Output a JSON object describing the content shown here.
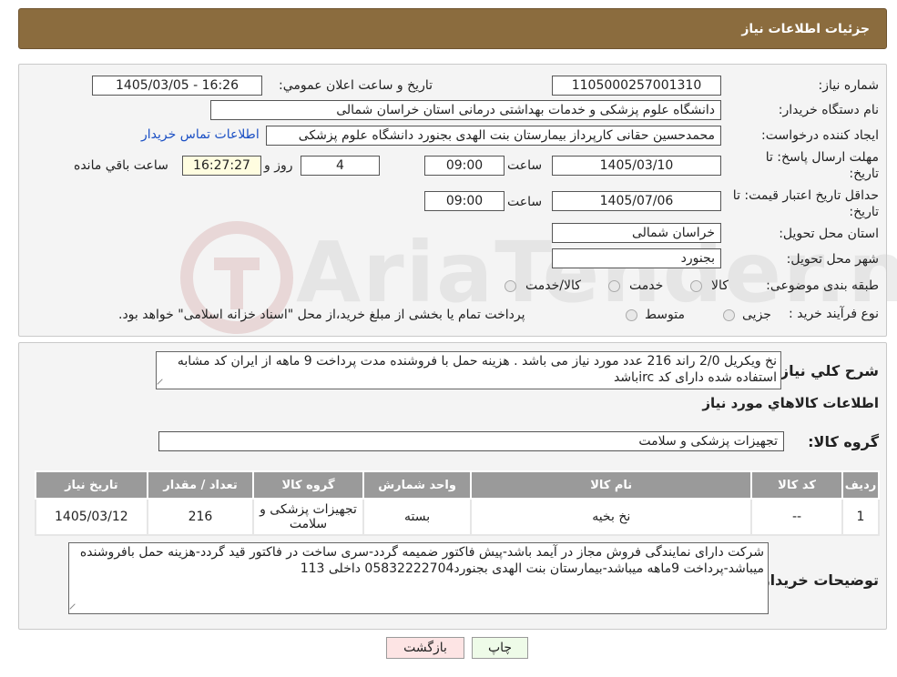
{
  "header": {
    "title": "جزئیات اطلاعات نیاز"
  },
  "form": {
    "need_number_label": "شماره نیاز:",
    "need_number": "1105000257001310",
    "announce_label": "تاریخ و ساعت اعلان عمومي:",
    "announce_value": "1405/03/05 - 16:26",
    "buyer_org_label": "نام دستگاه خريدار:",
    "buyer_org": "دانشگاه علوم پزشکی و خدمات بهداشتی درمانی استان خراسان شمالی",
    "requester_label": "ايجاد کننده درخواست:",
    "requester": "محمدحسین حقانی کارپرداز بیمارستان بنت الهدی بجنورد دانشگاه علوم پزشکی",
    "contact_link": "اطلاعات تماس خريدار",
    "deadline_label": "مهلت ارسال پاسخ: تا تاريخ:",
    "deadline_date": "1405/03/10",
    "time_label": "ساعت",
    "deadline_time": "09:00",
    "days_value": "4",
    "days_label": "روز و",
    "remaining_time": "16:27:27",
    "remaining_label": "ساعت باقي مانده",
    "validity_label": "حداقل تاريخ اعتبار قيمت: تا تاريخ:",
    "validity_date": "1405/07/06",
    "validity_time": "09:00",
    "province_label": "استان محل تحويل:",
    "province": "خراسان شمالی",
    "city_label": "شهر محل تحويل:",
    "city": "بجنورد",
    "category_label": "طبقه بندی موضوعی:",
    "category_options": [
      "کالا",
      "خدمت",
      "کالا/خدمت"
    ],
    "process_label": "نوع فرآيند خريد :",
    "process_options": [
      "جزیی",
      "متوسط"
    ],
    "process_note": "پرداخت تمام یا بخشی از مبلغ خرید،از محل \"اسناد خزانه اسلامی\" خواهد بود."
  },
  "description": {
    "label": "شرح کلي نياز:",
    "text": "نخ ویکریل 2/0 راند 216 عدد مورد نیاز می باشد . هزینه حمل با فروشنده مدت پرداخت 9 ماهه از ایران کد مشابه استفاده شده دارای کد ircباشد"
  },
  "goods": {
    "section_title": "اطلاعات کالاهاي مورد نياز",
    "group_label": "گروه کالا:",
    "group_value": "تجهیزات پزشکی و سلامت",
    "columns": [
      "رديف",
      "کد کالا",
      "نام کالا",
      "واحد شمارش",
      "گروه کالا",
      "تعداد / مقدار",
      "تاريخ نياز"
    ],
    "rows": [
      [
        "1",
        "--",
        "نخ بخیه",
        "بسته",
        "تجهیزات پزشکی و سلامت",
        "216",
        "1405/03/12"
      ]
    ]
  },
  "buyer_notes": {
    "label": "توضيحات خريدار:",
    "text": "شرکت دارای نمایندگی فروش مجاز در آیمد باشد-پیش فاکتور ضمیمه گردد-سری ساخت در فاکتور قید گردد-هزینه حمل بافروشنده میباشد-پرداخت 9ماهه میباشد-بیمارستان بنت الهدی بجنورد05832222704 داخلی 113"
  },
  "buttons": {
    "print": "چاپ",
    "back": "بازگشت"
  },
  "watermark": {
    "text": "AriaTender.neT"
  },
  "colors": {
    "header_bg": "#8b6c3e",
    "back_btn": "#fde4e4",
    "print_btn": "#eefbe8",
    "link": "#1a4fc4"
  }
}
